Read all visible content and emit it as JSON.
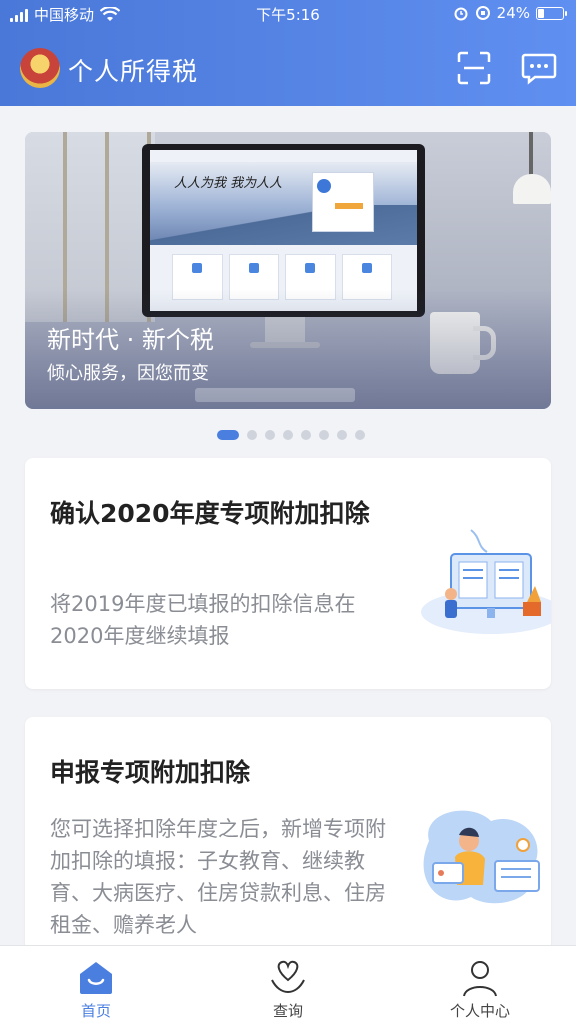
{
  "status_bar": {
    "carrier": "中国移动",
    "time": "下午5:16",
    "battery": "24%",
    "battery_level": 0.24
  },
  "header": {
    "title": "个人所得税",
    "icons": [
      "emblem-icon",
      "scan-icon",
      "message-icon"
    ]
  },
  "banner": {
    "title": "新时代 · 新个税",
    "subtitle": "倾心服务，因您而变",
    "pages": 8,
    "active_page": 1
  },
  "cards": [
    {
      "title": "确认2020年度专项附加扣除",
      "description": "将2019年度已填报的扣除信息在2020年度继续填报"
    },
    {
      "title": "申报专项附加扣除",
      "description": "您可选择扣除年度之后，新增专项附加扣除的填报：子女教育、继续教育、大病医疗、住房贷款利息、住房租金、赡养老人"
    }
  ],
  "tabbar": {
    "home": "首页",
    "query": "查询",
    "profile": "个人中心"
  },
  "colors": {
    "primary": "#4a7fe0",
    "header_gradient_start": "#4a78d9",
    "header_gradient_end": "#5f8ff0"
  }
}
